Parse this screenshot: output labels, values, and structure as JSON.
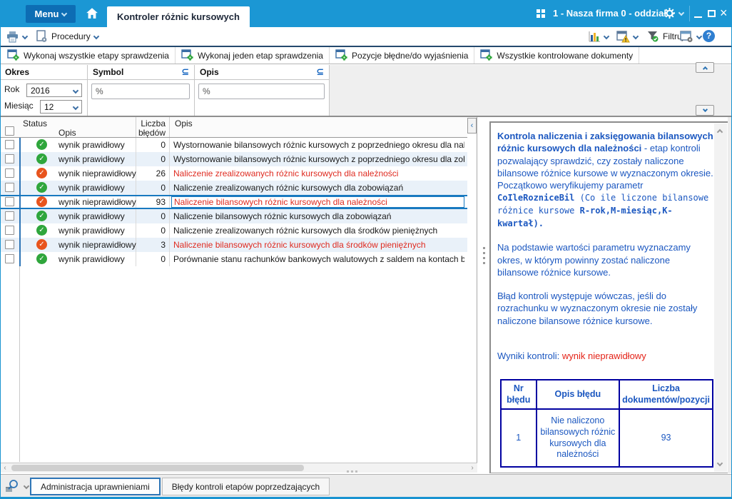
{
  "titlebar": {
    "menu_label": "Menu",
    "tab_title": "Kontroler różnic kursowych",
    "company": "1 - Nasza firma 0 - oddział"
  },
  "toolbar": {
    "procedures_label": "Procedury",
    "filter_label": "Filtruj",
    "help_label": "?",
    "action_buttons": [
      "Wykonaj wszystkie etapy sprawdzenia",
      "Wykonaj jeden etap sprawdzenia",
      "Pozycje błędne/do wyjaśnienia",
      "Wszystkie kontrolowane dokumenty"
    ]
  },
  "filters": {
    "okres_label": "Okres",
    "rok_label": "Rok",
    "rok_value": "2016",
    "miesiac_label": "Miesiąc",
    "miesiac_value": "12",
    "symbol_label": "Symbol",
    "symbol_value": "%",
    "opis_label": "Opis",
    "opis_value": "%",
    "operator_icon": "⊆"
  },
  "grid": {
    "headers": {
      "status": "Status",
      "status_opis": "Opis",
      "liczba_line1": "Liczba",
      "liczba_line2": "błędów",
      "opis": "Opis"
    },
    "rows": [
      {
        "ok": true,
        "status": "wynik prawidłowy",
        "errors": "0",
        "opis": "Wystornowanie bilansowych różnic kursowych z poprzedniego okresu dla należności",
        "selected": false
      },
      {
        "ok": true,
        "status": "wynik prawidłowy",
        "errors": "0",
        "opis": "Wystornowanie bilansowych różnic kursowych z poprzedniego okresu dla zobowiązań",
        "selected": false
      },
      {
        "ok": false,
        "status": "wynik nieprawidłowy",
        "errors": "26",
        "opis": "Naliczenie zrealizowanych różnic kursowych dla należności",
        "selected": false
      },
      {
        "ok": true,
        "status": "wynik prawidłowy",
        "errors": "0",
        "opis": "Naliczenie zrealizowanych różnic kursowych dla zobowiązań",
        "selected": false
      },
      {
        "ok": false,
        "status": "wynik nieprawidłowy",
        "errors": "93",
        "opis": "Naliczenie bilansowych różnic kursowych dla należności",
        "selected": true
      },
      {
        "ok": true,
        "status": "wynik prawidłowy",
        "errors": "0",
        "opis": "Naliczenie bilansowych różnic kursowych dla zobowiązań",
        "selected": false
      },
      {
        "ok": true,
        "status": "wynik prawidłowy",
        "errors": "0",
        "opis": "Naliczenie zrealizowanych różnic kursowych dla środków pieniężnych",
        "selected": false
      },
      {
        "ok": false,
        "status": "wynik nieprawidłowy",
        "errors": "3",
        "opis": "Naliczenie bilansowych różnic kursowych dla środków pieniężnych",
        "selected": false
      },
      {
        "ok": true,
        "status": "wynik prawidłowy",
        "errors": "0",
        "opis": "Porównanie stanu rachunków bankowych walutowych z saldem na kontach bankowych",
        "selected": false
      }
    ]
  },
  "detail": {
    "intro_bold": "Kontrola naliczenia i zaksięgowania bilansowych różnic kursowych dla należności",
    "intro_rest": " - etap kontroli pozwalający sprawdzić, czy zostały naliczone bilansowe różnice kursowe w wyznaczonym okresie.  Początkowo weryfikujemy parametr ",
    "code1": "CoIleRozniceBil",
    "code_mid": " (Co ile liczone bilansowe różnice kursowe ",
    "code2": "R-rok,M-miesiąc,K-kwartał).",
    "para2": "Na podstawie wartości parametru wyznaczamy okres, w którym powinny zostać naliczone bilansowe różnice kursowe.",
    "para3": "Błąd kontroli występuje wówczas, jeśli do rozrachunku w wyznaczonym okresie nie zostały naliczone bilansowe różnice kursowe.",
    "results_label": "Wyniki kontroli:",
    "results_value": "wynik nieprawidłowy",
    "table": {
      "headers": [
        "Nr błędu",
        "Opis błędu",
        "Liczba dokumentów/pozycji"
      ],
      "rows": [
        [
          "1",
          "Nie naliczono bilansowych różnic kursowych dla należności",
          "93"
        ]
      ]
    }
  },
  "bottom": {
    "tabs": [
      "Administracja uprawnieniami",
      "Błędy kontroli etapów poprzedzających"
    ]
  },
  "icons": {
    "check": "✓",
    "subset": "⊆"
  },
  "colors": {
    "titlebar_blue": "#1b97d4",
    "menu_button_blue": "#0d6db4",
    "selected_border_blue": "#1879c0",
    "link_blue": "#1467c8",
    "ok_green": "#2fa63c",
    "error_orange": "#e8541d",
    "error_text_red": "#df2a1f",
    "panel_text_blue": "#1b57c0",
    "panel_table_border_navy": "#0101a1",
    "result_red": "#e42217"
  }
}
